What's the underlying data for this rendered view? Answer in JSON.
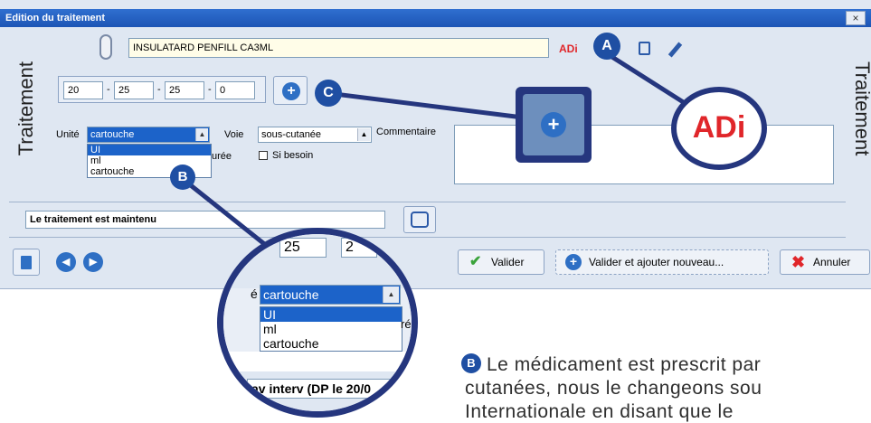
{
  "window": {
    "title": "Edition du traitement",
    "close_label": "×"
  },
  "medication": {
    "name": "INSULATARD PENFILL CA3ML",
    "adi_badge": "ADi"
  },
  "dose_fields": [
    "20",
    "25",
    "25",
    "0"
  ],
  "side_labels": {
    "left": "Traitement",
    "right": "Traitement"
  },
  "form": {
    "unite_label": "Unité",
    "unite_value": "cartouche",
    "unite_options": [
      "UI",
      "ml",
      "cartouche"
    ],
    "voie_label": "Voie",
    "voie_value": "sous-cutanée",
    "commentaire_label": "Commentaire",
    "duree_label_fragment": "urée",
    "si_besoin_label": "Si besoin"
  },
  "status": {
    "maintained_text": "Le traitement est maintenu"
  },
  "footer": {
    "valider_label": "Valider",
    "valider_ajouter_label": "Valider et ajouter nouveau...",
    "annuler_label": "Annuler"
  },
  "callouts": {
    "a": "A",
    "b": "B",
    "c": "C"
  },
  "zoom": {
    "adi_text": "ADi",
    "field_values": [
      "25",
      "2"
    ],
    "unite_fragment": "é",
    "unite_value": "cartouche",
    "options": [
      "UI",
      "ml",
      "cartouche"
    ],
    "duree_fragment": "ré",
    "bottom_text": "av interv (DP le 20/0"
  },
  "description": {
    "badge": "B",
    "line1": "Le médicament est prescrit par",
    "line2": "cutanées, nous le changeons sou",
    "line3": "Internationale en disant que le"
  },
  "colors": {
    "accent": "#1f4fa3",
    "ring": "#25367e",
    "adi_red": "#e0262a"
  }
}
